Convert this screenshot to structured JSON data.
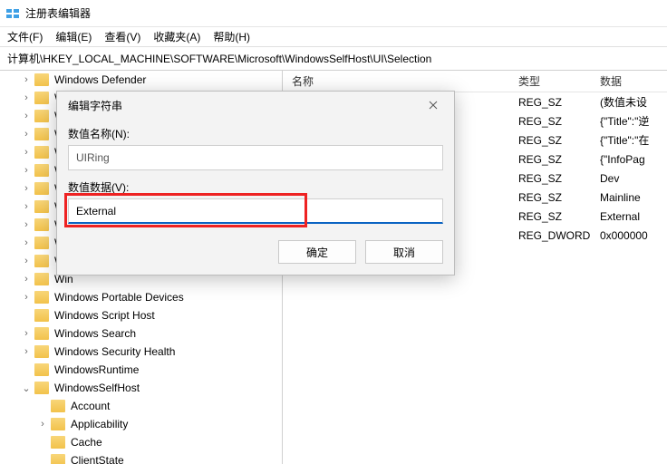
{
  "app": {
    "title": "注册表编辑器"
  },
  "menu": {
    "file": "文件(F)",
    "edit": "编辑(E)",
    "view": "查看(V)",
    "favorites": "收藏夹(A)",
    "help": "帮助(H)"
  },
  "address": "计算机\\HKEY_LOCAL_MACHINE\\SOFTWARE\\Microsoft\\WindowsSelfHost\\UI\\Selection",
  "tree": [
    {
      "depth": 1,
      "toggle": "closed",
      "label": "Windows Defender"
    },
    {
      "depth": 1,
      "toggle": "closed",
      "label": "Wi"
    },
    {
      "depth": 1,
      "toggle": "closed",
      "label": "Wi"
    },
    {
      "depth": 1,
      "toggle": "closed",
      "label": "Win"
    },
    {
      "depth": 1,
      "toggle": "closed",
      "label": "Win"
    },
    {
      "depth": 1,
      "toggle": "closed",
      "label": "Win"
    },
    {
      "depth": 1,
      "toggle": "closed",
      "label": "Win"
    },
    {
      "depth": 1,
      "toggle": "closed",
      "label": "Win"
    },
    {
      "depth": 1,
      "toggle": "closed",
      "label": "Wi"
    },
    {
      "depth": 1,
      "toggle": "closed",
      "label": "Win"
    },
    {
      "depth": 1,
      "toggle": "closed",
      "label": "Win"
    },
    {
      "depth": 1,
      "toggle": "closed",
      "label": "Win"
    },
    {
      "depth": 1,
      "toggle": "closed",
      "label": "Windows Portable Devices"
    },
    {
      "depth": 1,
      "toggle": "",
      "label": "Windows Script Host"
    },
    {
      "depth": 1,
      "toggle": "closed",
      "label": "Windows Search"
    },
    {
      "depth": 1,
      "toggle": "closed",
      "label": "Windows Security Health"
    },
    {
      "depth": 1,
      "toggle": "",
      "label": "WindowsRuntime"
    },
    {
      "depth": 1,
      "toggle": "open",
      "label": "WindowsSelfHost"
    },
    {
      "depth": 2,
      "toggle": "",
      "label": "Account"
    },
    {
      "depth": 2,
      "toggle": "closed",
      "label": "Applicability"
    },
    {
      "depth": 2,
      "toggle": "",
      "label": "Cache"
    },
    {
      "depth": 2,
      "toggle": "",
      "label": "ClientState"
    }
  ],
  "list_header": {
    "name": "名称",
    "type": "类型",
    "data": "数据"
  },
  "list": [
    {
      "type": "REG_SZ",
      "data": "(数值未设"
    },
    {
      "type": "REG_SZ",
      "data": "{\"Title\":\"逆"
    },
    {
      "type": "REG_SZ",
      "data": "{\"Title\":\"在"
    },
    {
      "type": "REG_SZ",
      "data": "{\"InfoPag"
    },
    {
      "type": "REG_SZ",
      "data": "Dev"
    },
    {
      "type": "REG_SZ",
      "data": "Mainline"
    },
    {
      "type": "REG_SZ",
      "data": "External"
    },
    {
      "type": "REG_DWORD",
      "data": "0x000000"
    }
  ],
  "dialog": {
    "title": "编辑字符串",
    "name_label": "数值名称(N):",
    "name_value": "UIRing",
    "data_label": "数值数据(V):",
    "data_value": "External",
    "ok": "确定",
    "cancel": "取消"
  }
}
